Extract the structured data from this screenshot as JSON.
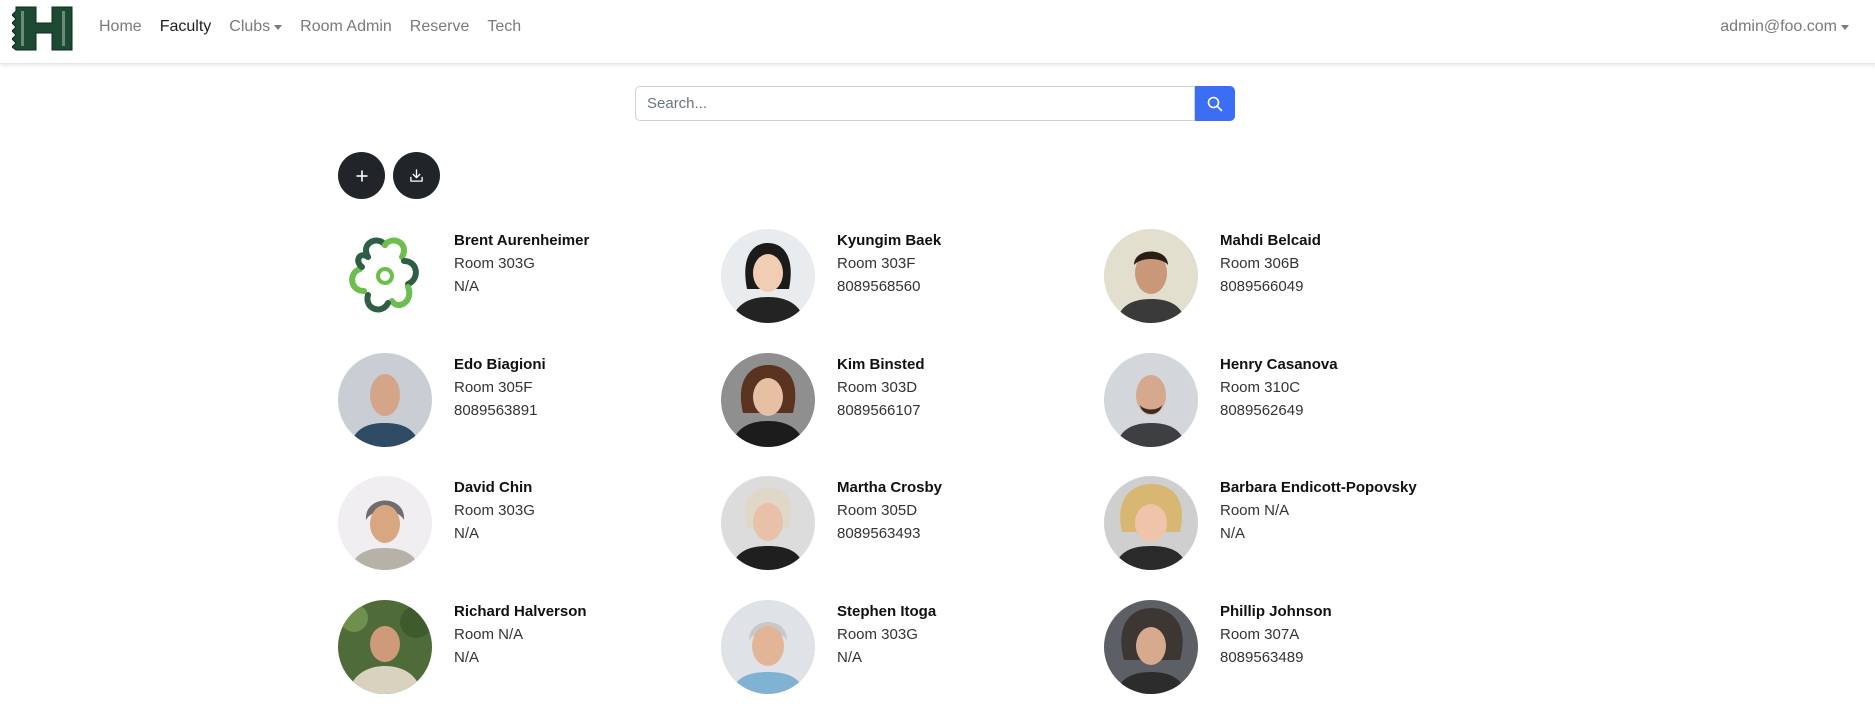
{
  "nav": {
    "items": [
      {
        "label": "Home",
        "active": false,
        "dropdown": false
      },
      {
        "label": "Faculty",
        "active": true,
        "dropdown": false
      },
      {
        "label": "Clubs",
        "active": false,
        "dropdown": true
      },
      {
        "label": "Room Admin",
        "active": false,
        "dropdown": false
      },
      {
        "label": "Reserve",
        "active": false,
        "dropdown": false
      },
      {
        "label": "Tech",
        "active": false,
        "dropdown": false
      }
    ],
    "user": "admin@foo.com",
    "logo_letter": "H"
  },
  "search": {
    "placeholder": "Search...",
    "value": "",
    "button_icon": "search-icon"
  },
  "actions": {
    "add_icon": "plus-icon",
    "download_icon": "download-icon"
  },
  "faculty": [
    {
      "name": "Brent Aurenheimer",
      "room": "Room 303G",
      "phone": "N/A",
      "avatar": "flower-logo"
    },
    {
      "name": "Kyungim Baek",
      "room": "Room 303F",
      "phone": "8089568560",
      "avatar": "photo"
    },
    {
      "name": "Mahdi Belcaid",
      "room": "Room 306B",
      "phone": "8089566049",
      "avatar": "photo"
    },
    {
      "name": "Edo Biagioni",
      "room": "Room 305F",
      "phone": "8089563891",
      "avatar": "photo"
    },
    {
      "name": "Kim Binsted",
      "room": "Room 303D",
      "phone": "8089566107",
      "avatar": "photo"
    },
    {
      "name": "Henry Casanova",
      "room": "Room 310C",
      "phone": "8089562649",
      "avatar": "photo"
    },
    {
      "name": "David Chin",
      "room": "Room 303G",
      "phone": "N/A",
      "avatar": "photo"
    },
    {
      "name": "Martha Crosby",
      "room": "Room 305D",
      "phone": "8089563493",
      "avatar": "photo"
    },
    {
      "name": "Barbara Endicott-Popovsky",
      "room": "Room N/A",
      "phone": "N/A",
      "avatar": "photo"
    },
    {
      "name": "Richard Halverson",
      "room": "Room N/A",
      "phone": "N/A",
      "avatar": "photo"
    },
    {
      "name": "Stephen Itoga",
      "room": "Room 303G",
      "phone": "N/A",
      "avatar": "photo"
    },
    {
      "name": "Phillip Johnson",
      "room": "Room 307A",
      "phone": "8089563489",
      "avatar": "photo"
    }
  ],
  "colors": {
    "primary": "#3b6ef5",
    "dark": "#212529",
    "logo_green": "#1d4a33"
  }
}
